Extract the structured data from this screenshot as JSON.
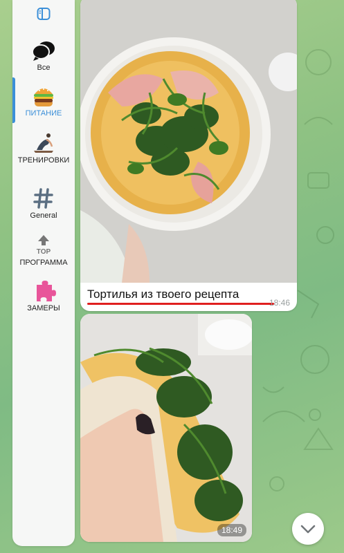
{
  "sidebar": {
    "folders": [
      {
        "label": "Все",
        "icon": "chats-icon"
      },
      {
        "label": "ПИТАНИЕ",
        "icon": "burger-icon",
        "active": true
      },
      {
        "label": "ТРЕНИРОВКИ",
        "icon": "yoga-icon"
      },
      {
        "label": "General",
        "icon": "hashtag-icon"
      },
      {
        "label": "ПРОГРАММА",
        "icon": "top-arrow-icon"
      },
      {
        "label": "ЗАМЕРЫ",
        "icon": "puzzle-icon"
      }
    ]
  },
  "messages": [
    {
      "caption": "Тортилья из твоего рецепта",
      "time": "18:46"
    },
    {
      "caption": "",
      "time": "18:49"
    }
  ],
  "colors": {
    "accent": "#3b8fd8",
    "underline": "#e01f1f"
  }
}
